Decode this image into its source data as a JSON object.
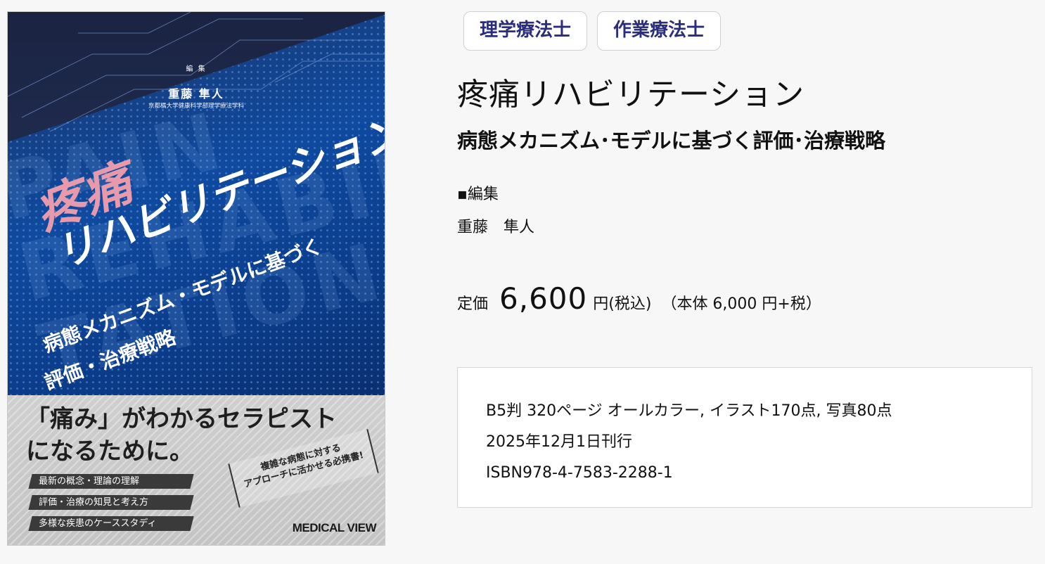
{
  "cover": {
    "editor_label": "編 集",
    "editor_name": "重藤 隼人",
    "editor_affiliation": "京都橘大学健康科学部理学療法学科",
    "bg_words": "PAIN\nREHABILI\nTATION",
    "title_pain": "疼痛",
    "title_rest": "リハビリテーション",
    "subtitle_line1": "病態メカニズム・モデルに基づく",
    "subtitle_line2": "評価・治療戦略",
    "catchcopy": "「痛み」がわかるセラピスト\nになるために。",
    "features": [
      "最新の概念・理論の理解",
      "評価・治療の知見と考え方",
      "多様な疾患のケーススタディ"
    ],
    "stamp": "複雑な病態に対する\nアプローチに活かせる必携書!",
    "publisher": "MEDICAL VIEW"
  },
  "tags": [
    "理学療法士",
    "作業療法士"
  ],
  "title": "疼痛リハビリテーション",
  "subtitle": "病態メカニズム･モデルに基づく評価･治療戦略",
  "editor": {
    "label": "▪編集",
    "name": "重藤　隼人"
  },
  "price": {
    "label": "定価",
    "value": "6,600",
    "yen_tax": "円(税込)",
    "base": "（本体 6,000 円+税）"
  },
  "specs": {
    "format": "B5判  320ページ  オールカラー,  イラスト170点,  写真80点",
    "date": "2025年12月1日刊行",
    "isbn": "ISBN978-4-7583-2288-1"
  }
}
